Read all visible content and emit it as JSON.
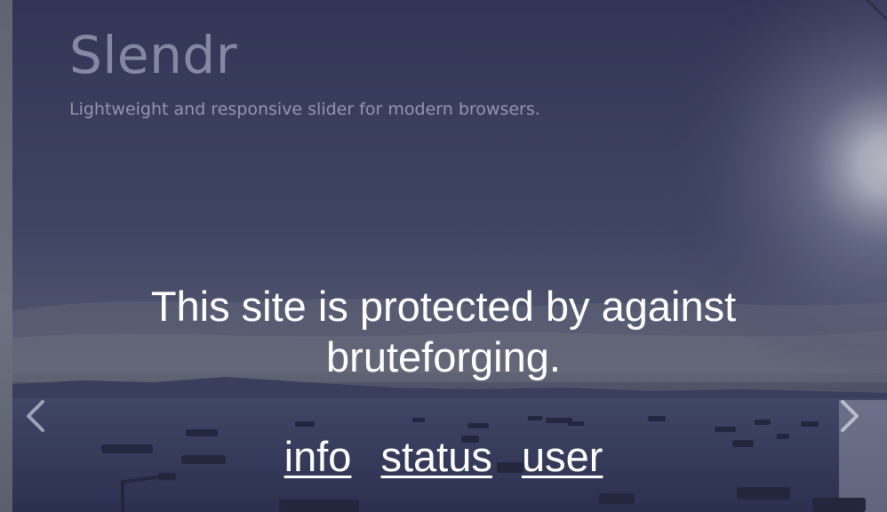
{
  "header": {
    "title": "Slendr",
    "tagline": "Lightweight and responsive slider for modern browsers."
  },
  "main": {
    "headline": "This site is protected by against bruteforging."
  },
  "links": [
    {
      "label": "info"
    },
    {
      "label": "status"
    },
    {
      "label": "user"
    }
  ],
  "slider": {
    "prev_icon": "chevron-left-icon",
    "next_icon": "chevron-right-icon"
  },
  "colors": {
    "overlay": "#3b3e58",
    "text": "#ffffff"
  }
}
